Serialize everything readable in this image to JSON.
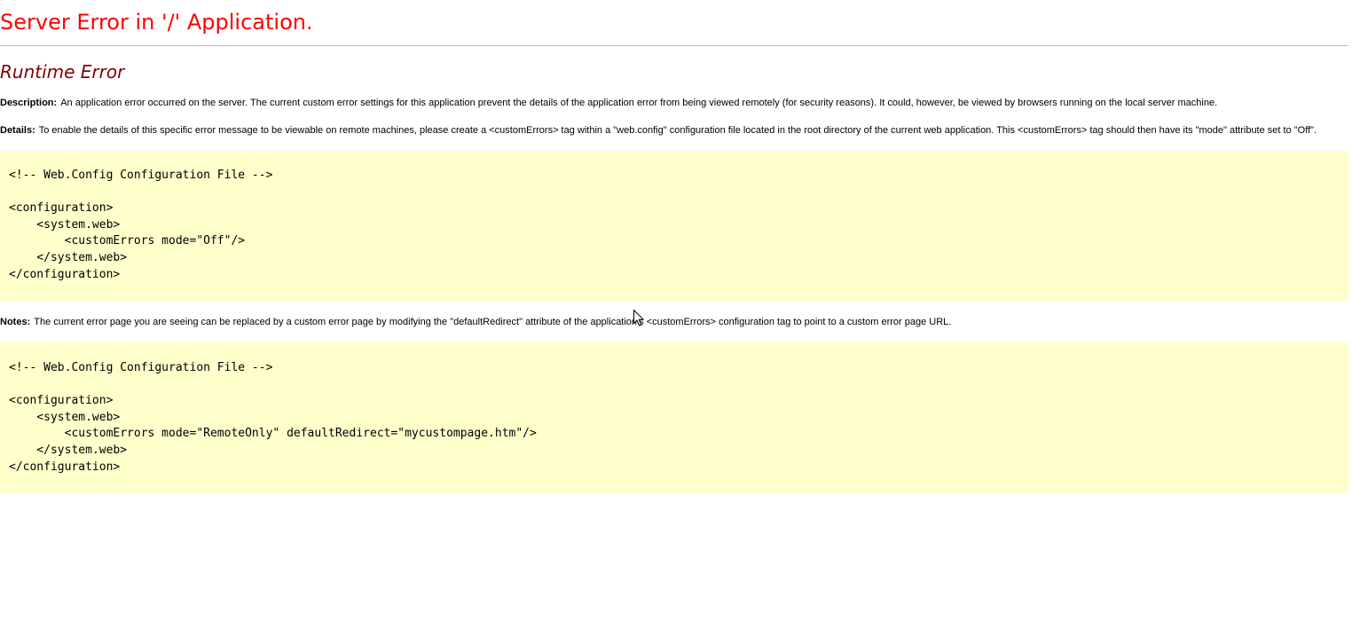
{
  "page": {
    "title": "Server Error in '/' Application.",
    "subtitle": "Runtime Error"
  },
  "description": {
    "label": "Description:",
    "text": "An application error occurred on the server. The current custom error settings for this application prevent the details of the application error from being viewed remotely (for security reasons). It could, however, be viewed by browsers running on the local server machine."
  },
  "details": {
    "label": "Details:",
    "text": "To enable the details of this specific error message to be viewable on remote machines, please create a <customErrors> tag within a \"web.config\" configuration file located in the root directory of the current web application. This <customErrors> tag should then have its \"mode\" attribute set to \"Off\"."
  },
  "code_block_1": {
    "lines": [
      "",
      "<!-- Web.Config Configuration File -->",
      "",
      "<configuration>",
      "    <system.web>",
      "        <customErrors mode=\"Off\"/>",
      "    </system.web>",
      "</configuration>"
    ]
  },
  "notes": {
    "label": "Notes:",
    "text": "The current error page you are seeing can be replaced by a custom error page by modifying the \"defaultRedirect\" attribute of the application's <customErrors> configuration tag to point to a custom error page URL."
  },
  "code_block_2": {
    "lines": [
      "",
      "<!-- Web.Config Configuration File -->",
      "",
      "<configuration>",
      "    <system.web>",
      "        <customErrors mode=\"RemoteOnly\" defaultRedirect=\"mycustompage.htm\"/>",
      "    </system.web>",
      "</configuration>"
    ]
  },
  "icons": {
    "cursor": "mouse-pointer-icon"
  },
  "colors": {
    "title": "#ff0000",
    "subtitle": "#800000",
    "code_background": "#ffffcc",
    "divider": "#c0c0c0"
  }
}
